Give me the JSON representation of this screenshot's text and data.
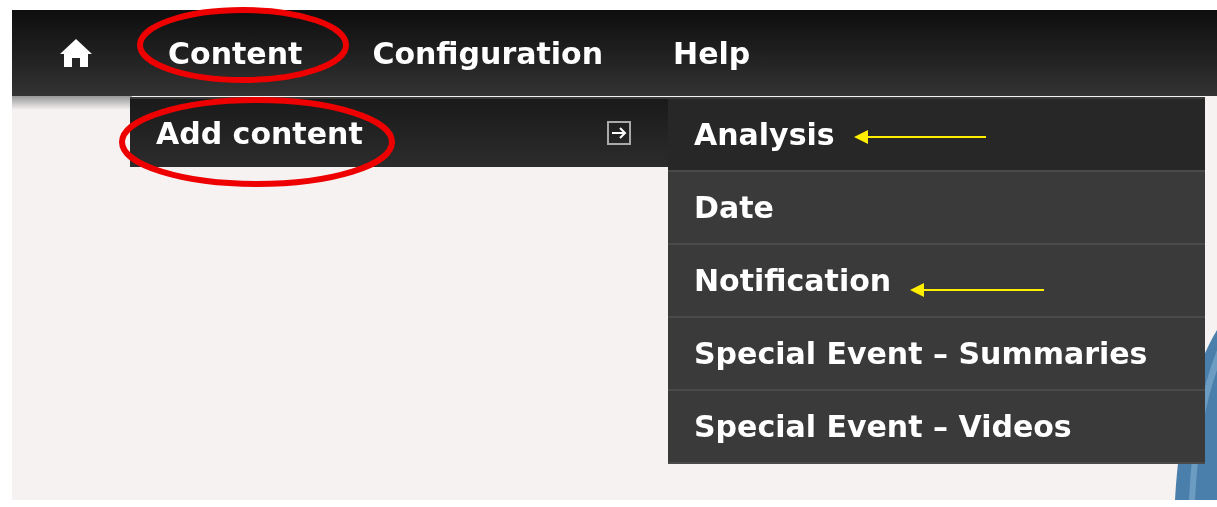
{
  "toolbar": {
    "items": [
      {
        "kind": "home"
      },
      {
        "kind": "link",
        "label": "Content"
      },
      {
        "kind": "link",
        "label": "Configuration"
      },
      {
        "kind": "link",
        "label": "Help"
      }
    ]
  },
  "submenu": {
    "items": [
      {
        "label": "Add content",
        "has_children": true
      }
    ]
  },
  "flyout": {
    "items": [
      {
        "label": "Analysis",
        "selected": true
      },
      {
        "label": "Date",
        "selected": false
      },
      {
        "label": "Notification",
        "selected": false
      },
      {
        "label": "Special Event – Summaries",
        "selected": false
      },
      {
        "label": "Special Event – Videos",
        "selected": false
      }
    ]
  }
}
